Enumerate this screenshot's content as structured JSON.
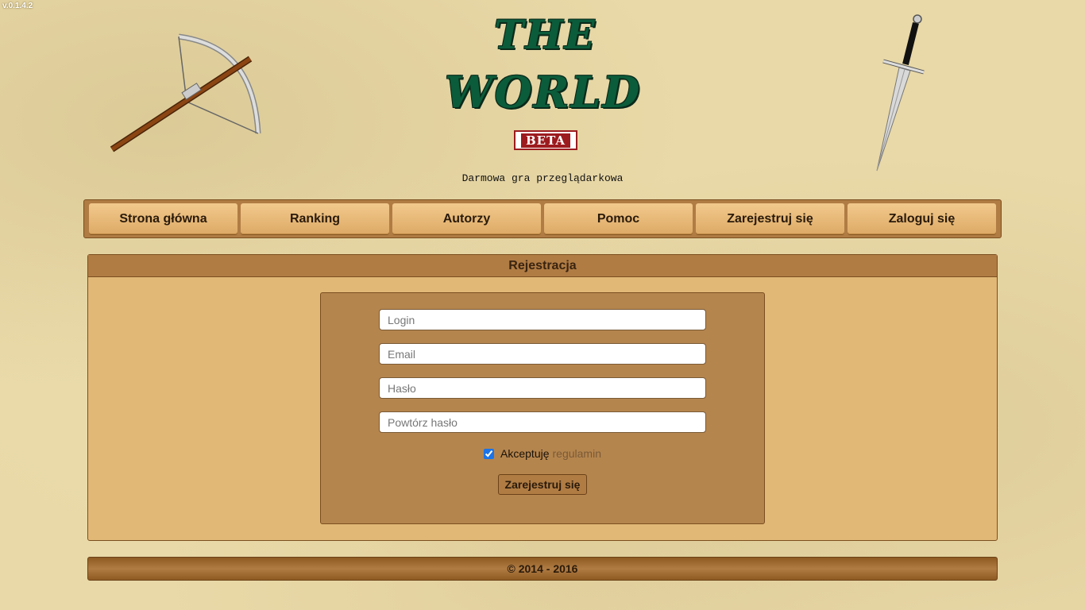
{
  "version": "v.0.1.4.2",
  "logo": {
    "line1": "THE",
    "line2": "WORLD",
    "badge": "BETA"
  },
  "subtitle": "Darmowa gra przeglądarkowa",
  "nav": {
    "items": [
      {
        "label": "Strona główna"
      },
      {
        "label": "Ranking"
      },
      {
        "label": "Autorzy"
      },
      {
        "label": "Pomoc"
      },
      {
        "label": "Zarejestruj się"
      },
      {
        "label": "Zaloguj się"
      }
    ]
  },
  "registration": {
    "title": "Rejestracja",
    "login": {
      "placeholder": "Login",
      "value": ""
    },
    "email": {
      "placeholder": "Email",
      "value": ""
    },
    "password": {
      "placeholder": "Hasło",
      "value": ""
    },
    "password_repeat": {
      "placeholder": "Powtórz hasło",
      "value": ""
    },
    "terms_label": "Akceptuję",
    "terms_link": "regulamin",
    "terms_checked": true,
    "submit_label": "Zarejestruj się"
  },
  "footer": {
    "copyright": "© 2014 - 2016"
  },
  "colors": {
    "panel": "#e2b877",
    "header": "#b07c44",
    "form": "#b5854e",
    "logo": "#0b5c3a",
    "beta": "#9c1b1f"
  }
}
